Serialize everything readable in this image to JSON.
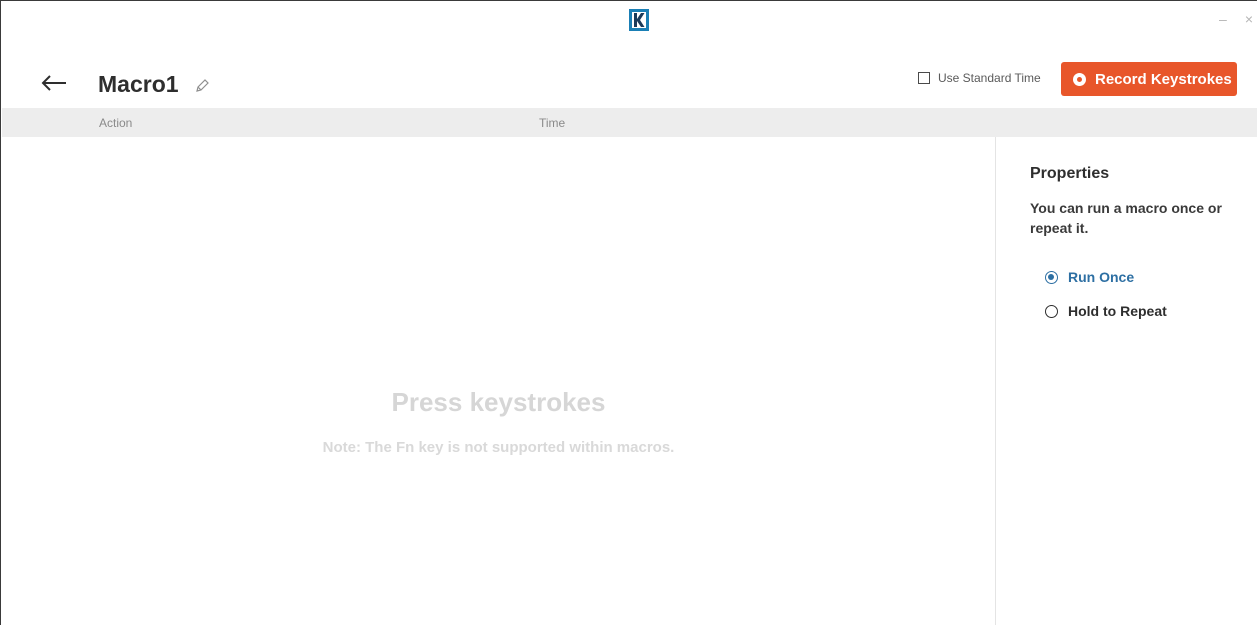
{
  "window": {
    "logo_icon": "kingston-k-logo-icon",
    "minimize_label": "–",
    "close_label": "×"
  },
  "header": {
    "back_icon": "arrow-left-icon",
    "title": "Macro1",
    "edit_icon": "pencil-icon",
    "standard_time_label": "Use Standard Time",
    "standard_time_checked": false,
    "record_label": "Record Keystrokes",
    "record_color": "#e8562a"
  },
  "table": {
    "columns": [
      "Action",
      "Time"
    ]
  },
  "empty_state": {
    "title": "Press keystrokes",
    "note": "Note: The Fn key is not supported within macros."
  },
  "properties": {
    "title": "Properties",
    "description": "You can run a macro once or repeat it.",
    "options": [
      {
        "label": "Run Once",
        "selected": true
      },
      {
        "label": "Hold to Repeat",
        "selected": false
      }
    ],
    "accent_color": "#2d6fa3"
  }
}
